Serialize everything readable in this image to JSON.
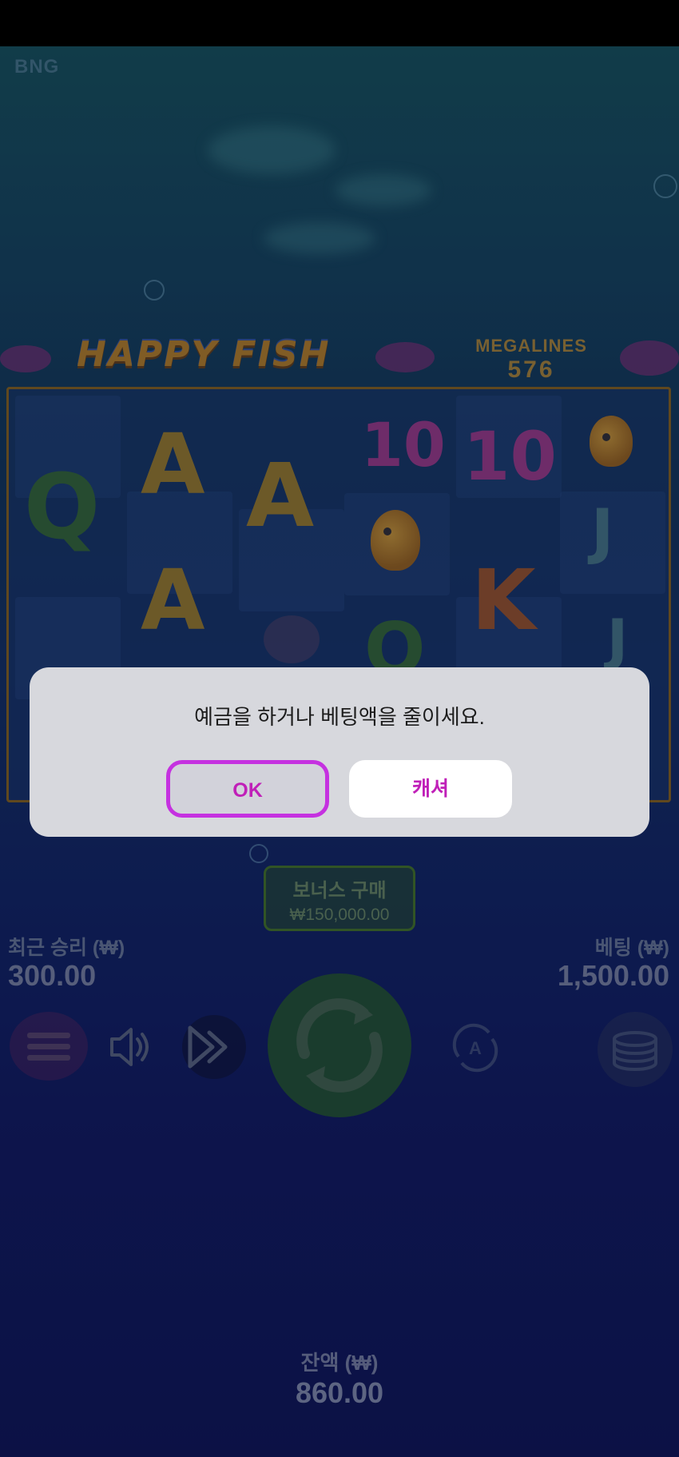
{
  "brand": "BNG",
  "game": {
    "logo_text": "HAPPY FISH",
    "megalines_label": "MEGALINES",
    "megalines_value": "576",
    "symbols": [
      "Q",
      "A",
      "A",
      "10",
      "10",
      "J",
      "A",
      "K",
      "J",
      "Q",
      "A"
    ]
  },
  "bonus_buy": {
    "label": "보너스 구매",
    "price": "₩150,000.00"
  },
  "last_win": {
    "label": "최근 승리 (₩)",
    "value": "300.00"
  },
  "bet": {
    "label": "베팅 (₩)",
    "value": "1,500.00"
  },
  "balance": {
    "label": "잔액 (₩)",
    "value": "860.00"
  },
  "controls": {
    "menu_icon": "menu-icon",
    "sound_icon": "speaker-icon",
    "turbo_icon": "fast-forward-icon",
    "spin_icon": "spin-icon",
    "autoplay_icon": "autoplay-icon",
    "bet_icon": "coin-stack-icon"
  },
  "dialog": {
    "message": "예금을 하거나 베팅액을 줄이세요.",
    "ok_label": "OK",
    "cashier_label": "캐셔"
  },
  "colors": {
    "accent": "#c531e0",
    "button_text": "#c020b8",
    "dialog_bg": "#d7d8dd"
  }
}
